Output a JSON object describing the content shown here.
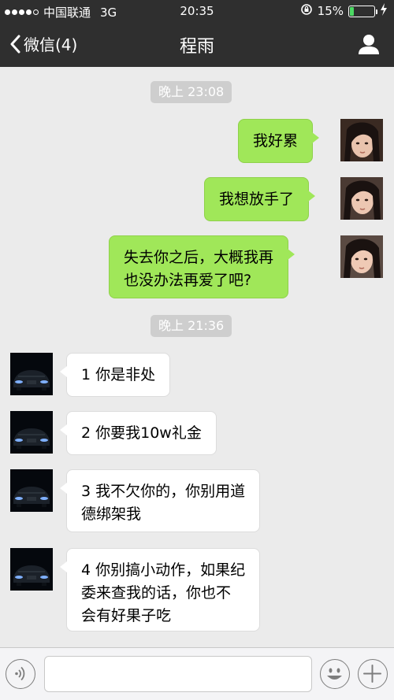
{
  "status_bar": {
    "carrier": "中国联通",
    "network": "3G",
    "time": "20:35",
    "battery_text": "15%",
    "battery_level": 0.15
  },
  "nav": {
    "back_label": "微信(4)",
    "title": "程雨"
  },
  "chat": {
    "timestamps": [
      "晚上 23:08",
      "晚上 21:36"
    ],
    "messages": [
      {
        "sender": "me",
        "text": "我好累"
      },
      {
        "sender": "me",
        "text": "我想放手了"
      },
      {
        "sender": "me",
        "lines": [
          "失去你之后，大概我再",
          "也没办法再爱了吧?"
        ]
      },
      {
        "sender": "them",
        "text": "1 你是非处"
      },
      {
        "sender": "them",
        "text": "2 你要我10w礼金"
      },
      {
        "sender": "them",
        "lines": [
          "3 我不欠你的，你别用道",
          "德绑架我"
        ]
      },
      {
        "sender": "them",
        "lines": [
          "4 你别搞小动作，如果纪",
          "委来查我的话，你也不",
          "会有好果子吃"
        ]
      }
    ]
  },
  "input": {
    "value": "",
    "placeholder": ""
  },
  "colors": {
    "nav_bg": "#2f2f2f",
    "chat_bg": "#ebebeb",
    "my_bubble": "#a0e759",
    "their_bubble": "#ffffff",
    "timestamp_chip": "#cecece"
  }
}
